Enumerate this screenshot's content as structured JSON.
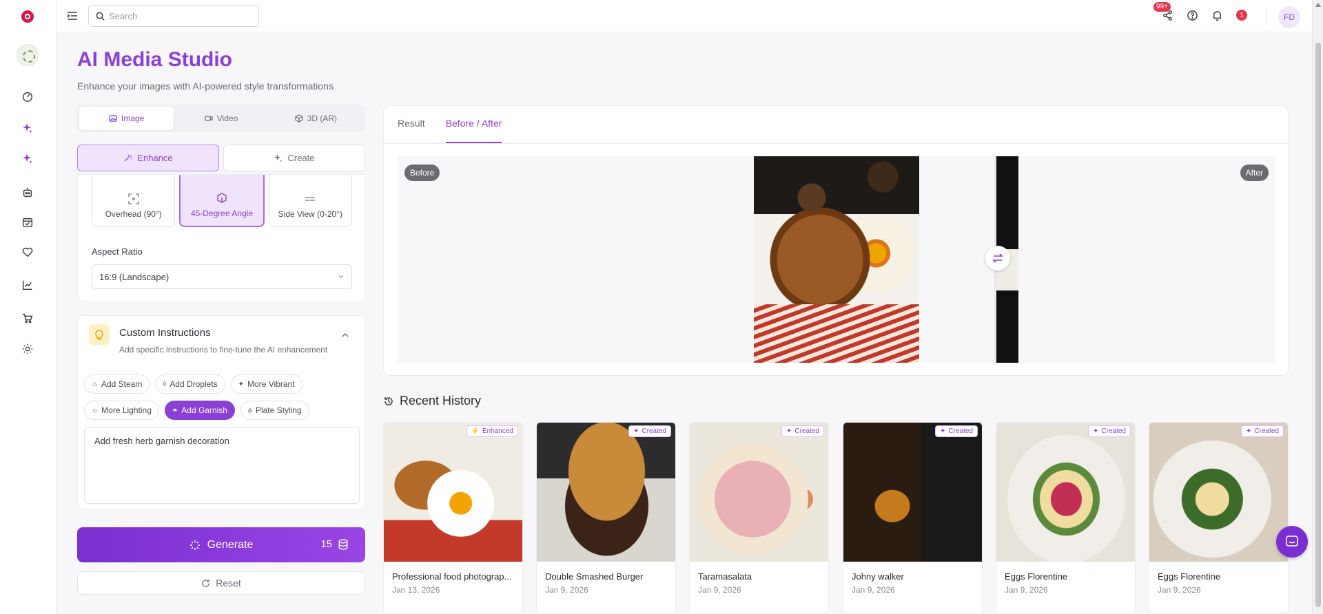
{
  "topbar": {
    "search_placeholder": "Search",
    "notifications_count": "99+",
    "alerts_count": "1",
    "avatar_initials": "FD"
  },
  "page": {
    "title": "AI Media Studio",
    "subtitle": "Enhance your images with AI-powered style transformations"
  },
  "mode_tabs": [
    {
      "label": "Image",
      "active": true
    },
    {
      "label": "Video",
      "active": false
    },
    {
      "label": "3D (AR)",
      "active": false
    }
  ],
  "sub_tabs": [
    {
      "label": "Enhance",
      "active": true
    },
    {
      "label": "Create",
      "active": false
    }
  ],
  "angles": [
    {
      "label": "Overhead (90°)",
      "active": false
    },
    {
      "label": "45-Degree Angle",
      "active": true
    },
    {
      "label": "Side View (0-20°)",
      "active": false
    }
  ],
  "aspect": {
    "label": "Aspect Ratio",
    "value": "16:9 (Landscape)"
  },
  "instructions": {
    "title": "Custom Instructions",
    "subtitle": "Add specific instructions to fine-tune the AI enhancement",
    "chips_row1": [
      "Add Steam",
      "Add Droplets",
      "More Vibrant"
    ],
    "chips_row2": [
      "More Lighting",
      "Add Garnish",
      "Plate Styling"
    ],
    "active_chip": "Add Garnish",
    "text": "Add fresh herb garnish decoration"
  },
  "generate": {
    "label": "Generate",
    "cost": "15"
  },
  "reset_label": "Reset",
  "result": {
    "tabs": [
      {
        "label": "Result",
        "active": false
      },
      {
        "label": "Before / After",
        "active": true
      }
    ],
    "before_label": "Before",
    "after_label": "After"
  },
  "history": {
    "title": "Recent History",
    "items": [
      {
        "name": "Professional food photograp...",
        "date": "Jan 13, 2026",
        "tag": "Enhanced"
      },
      {
        "name": "Double Smashed Burger",
        "date": "Jan 9, 2026",
        "tag": "Created"
      },
      {
        "name": "Taramasalata",
        "date": "Jan 9, 2026",
        "tag": "Created"
      },
      {
        "name": "Johny walker",
        "date": "Jan 9, 2026",
        "tag": "Created"
      },
      {
        "name": "Eggs Florentine",
        "date": "Jan 9, 2026",
        "tag": "Created"
      },
      {
        "name": "Eggs Florentine",
        "date": "Jan 9, 2026",
        "tag": "Created"
      }
    ]
  },
  "colors": {
    "accent": "#8a3fd6",
    "accent_light": "#f0e4fd",
    "alert": "#e5364e"
  },
  "icons": {
    "rail": [
      "dashboard-icon",
      "sparkle-icon",
      "sparkle-icon",
      "robot-icon",
      "calendar-check-icon",
      "heart-icon",
      "chart-line-icon",
      "cart-icon",
      "gear-icon"
    ]
  }
}
